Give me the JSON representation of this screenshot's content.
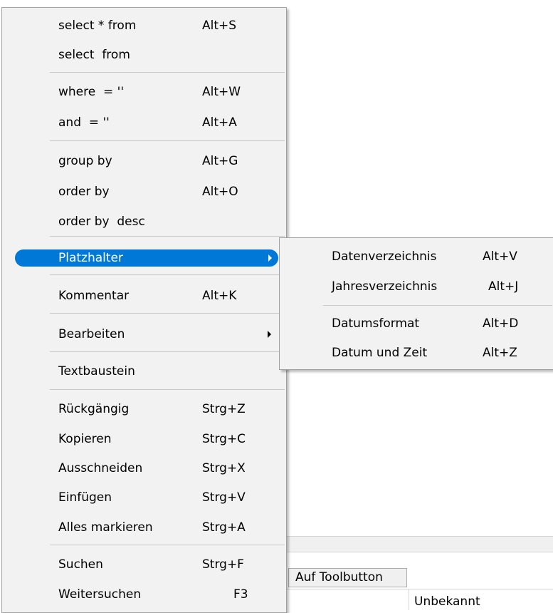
{
  "background": {
    "tab_label": "Auf Toolbutton",
    "cell_text": "Unbekannt"
  },
  "menu": {
    "items": [
      {
        "label": "select * from",
        "shortcut": "Alt+S"
      },
      {
        "label": "select  from",
        "shortcut": ""
      },
      {
        "label": "where  = ''",
        "shortcut": "Alt+W"
      },
      {
        "label": "and  = ''",
        "shortcut": "Alt+A"
      },
      {
        "label": "group by",
        "shortcut": "Alt+G"
      },
      {
        "label": "order by",
        "shortcut": "Alt+O"
      },
      {
        "label": "order by  desc",
        "shortcut": ""
      },
      {
        "label": "Platzhalter",
        "shortcut": "",
        "submenu": true,
        "highlighted": true
      },
      {
        "label": "Kommentar",
        "shortcut": "Alt+K"
      },
      {
        "label": "Bearbeiten",
        "shortcut": "",
        "submenu": true
      },
      {
        "label": "Textbaustein",
        "shortcut": ""
      },
      {
        "label": "Rückgängig",
        "shortcut": "Strg+Z"
      },
      {
        "label": "Kopieren",
        "shortcut": "Strg+C"
      },
      {
        "label": "Ausschneiden",
        "shortcut": "Strg+X"
      },
      {
        "label": "Einfügen",
        "shortcut": "Strg+V"
      },
      {
        "label": "Alles markieren",
        "shortcut": "Strg+A"
      },
      {
        "label": "Suchen",
        "shortcut": "Strg+F"
      },
      {
        "label": "Weitersuchen",
        "shortcut": "F3"
      }
    ]
  },
  "submenu": {
    "items": [
      {
        "label": "Datenverzeichnis",
        "shortcut": "Alt+V"
      },
      {
        "label": "Jahresverzeichnis",
        "shortcut": "Alt+J"
      },
      {
        "label": "Datumsformat",
        "shortcut": "Alt+D"
      },
      {
        "label": "Datum und Zeit",
        "shortcut": "Alt+Z"
      }
    ]
  },
  "colors": {
    "highlight": "#0078d7",
    "menu_background": "#f2f2f2"
  }
}
